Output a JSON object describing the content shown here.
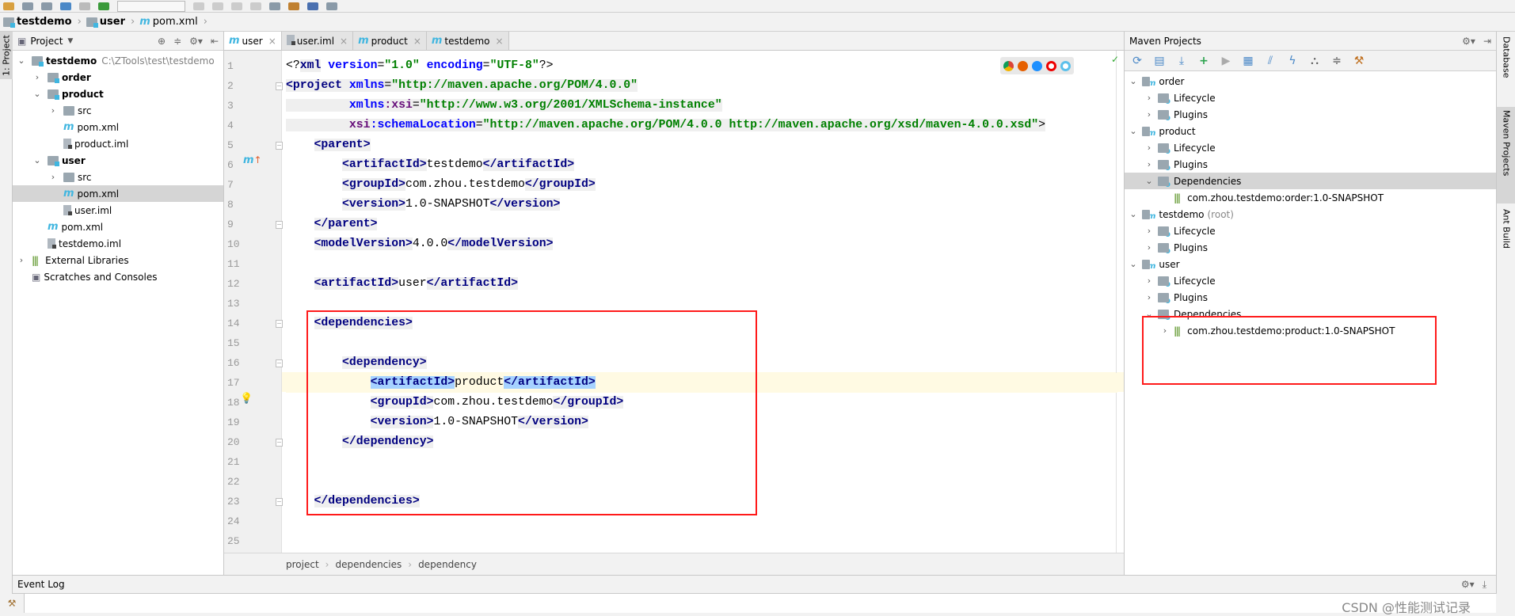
{
  "navbar": {
    "crumbs": [
      "testdemo",
      "user",
      "pom.xml"
    ]
  },
  "left_strip": {
    "project_tab": "1: Project"
  },
  "project_panel": {
    "title": "Project",
    "items": [
      {
        "label": "testdemo",
        "path": "C:\\ZTools\\test\\testdemo",
        "depth": 0,
        "arrow": "open",
        "icon": "module-folder",
        "bold": true
      },
      {
        "label": "order",
        "depth": 1,
        "arrow": "closed",
        "icon": "module-folder",
        "bold": true
      },
      {
        "label": "product",
        "depth": 1,
        "arrow": "open",
        "icon": "module-folder",
        "bold": true
      },
      {
        "label": "src",
        "depth": 2,
        "arrow": "closed",
        "icon": "folder"
      },
      {
        "label": "pom.xml",
        "depth": 2,
        "icon": "maven-file"
      },
      {
        "label": "product.iml",
        "depth": 2,
        "icon": "iml-file"
      },
      {
        "label": "user",
        "depth": 1,
        "arrow": "open",
        "icon": "module-folder",
        "bold": true
      },
      {
        "label": "src",
        "depth": 2,
        "arrow": "closed",
        "icon": "folder"
      },
      {
        "label": "pom.xml",
        "depth": 2,
        "icon": "maven-file",
        "selected": true
      },
      {
        "label": "user.iml",
        "depth": 2,
        "icon": "iml-file"
      },
      {
        "label": "pom.xml",
        "depth": 1,
        "icon": "maven-file"
      },
      {
        "label": "testdemo.iml",
        "depth": 1,
        "icon": "iml-file"
      },
      {
        "label": "External Libraries",
        "depth": 0,
        "arrow": "closed",
        "icon": "library"
      },
      {
        "label": "Scratches and Consoles",
        "depth": 0,
        "icon": "scratches"
      }
    ]
  },
  "editor": {
    "tabs": [
      {
        "label": "user",
        "icon": "maven-file",
        "active": true
      },
      {
        "label": "user.iml",
        "icon": "iml-file"
      },
      {
        "label": "product",
        "icon": "maven-file"
      },
      {
        "label": "testdemo",
        "icon": "maven-file"
      }
    ],
    "close_glyph": "×",
    "current_line": 17,
    "lines": [
      [
        [
          "punct",
          "<?"
        ],
        [
          "tag",
          "xml"
        ],
        [
          "attr",
          " version"
        ],
        [
          "punct",
          "="
        ],
        [
          "val",
          "\"1.0\""
        ],
        [
          "attr",
          " encoding"
        ],
        [
          "punct",
          "="
        ],
        [
          "val",
          "\"UTF-8\""
        ],
        [
          "punct",
          "?>"
        ]
      ],
      [
        [
          "tag",
          "<project"
        ],
        [
          "attr",
          " xmlns"
        ],
        [
          "punct",
          "="
        ],
        [
          "val",
          "\"http://maven.apache.org/POM/4.0.0\""
        ]
      ],
      [
        [
          "text",
          "         "
        ],
        [
          "attr",
          "xmlns"
        ],
        [
          "ns",
          ":xsi"
        ],
        [
          "punct",
          "="
        ],
        [
          "val",
          "\"http://www.w3.org/2001/XMLSchema-instance\""
        ]
      ],
      [
        [
          "text",
          "         "
        ],
        [
          "ns",
          "xsi"
        ],
        [
          "attr",
          ":schemaLocation"
        ],
        [
          "punct",
          "="
        ],
        [
          "val",
          "\"http://maven.apache.org/POM/4.0.0 http://maven.apache.org/xsd/maven-4.0.0.xsd\""
        ],
        [
          "punct",
          ">"
        ]
      ],
      [
        [
          "text",
          "    "
        ],
        [
          "tag",
          "<parent>"
        ]
      ],
      [
        [
          "text",
          "        "
        ],
        [
          "tag",
          "<artifactId>"
        ],
        [
          "text",
          "testdemo"
        ],
        [
          "tag",
          "</artifactId>"
        ]
      ],
      [
        [
          "text",
          "        "
        ],
        [
          "tag",
          "<groupId>"
        ],
        [
          "text",
          "com.zhou.testdemo"
        ],
        [
          "tag",
          "</groupId>"
        ]
      ],
      [
        [
          "text",
          "        "
        ],
        [
          "tag",
          "<version>"
        ],
        [
          "text",
          "1.0-SNAPSHOT"
        ],
        [
          "tag",
          "</version>"
        ]
      ],
      [
        [
          "text",
          "    "
        ],
        [
          "tag",
          "</parent>"
        ]
      ],
      [
        [
          "text",
          "    "
        ],
        [
          "tag",
          "<modelVersion>"
        ],
        [
          "text",
          "4.0.0"
        ],
        [
          "tag",
          "</modelVersion>"
        ]
      ],
      [],
      [
        [
          "text",
          "    "
        ],
        [
          "tag",
          "<artifactId>"
        ],
        [
          "text",
          "user"
        ],
        [
          "tag",
          "</artifactId>"
        ]
      ],
      [],
      [
        [
          "text",
          "    "
        ],
        [
          "tag",
          "<dependencies>"
        ]
      ],
      [],
      [
        [
          "text",
          "        "
        ],
        [
          "tag",
          "<dependency>"
        ]
      ],
      [
        [
          "text",
          "            "
        ],
        [
          "sel",
          "<artifactId>"
        ],
        [
          "text",
          "product"
        ],
        [
          "sel",
          "</artifactId>"
        ]
      ],
      [
        [
          "text",
          "            "
        ],
        [
          "tag",
          "<groupId>"
        ],
        [
          "text",
          "com.zhou.testdemo"
        ],
        [
          "tag",
          "</groupId>"
        ]
      ],
      [
        [
          "text",
          "            "
        ],
        [
          "tag",
          "<version>"
        ],
        [
          "text",
          "1.0-SNAPSHOT"
        ],
        [
          "tag",
          "</version>"
        ]
      ],
      [
        [
          "text",
          "        "
        ],
        [
          "tag",
          "</dependency>"
        ]
      ],
      [],
      [],
      [
        [
          "text",
          "    "
        ],
        [
          "tag",
          "</dependencies>"
        ]
      ],
      [],
      []
    ],
    "breadcrumb": [
      "project",
      "dependencies",
      "dependency"
    ]
  },
  "maven_panel": {
    "title": "Maven Projects",
    "items": [
      {
        "label": "order",
        "depth": 0,
        "arrow": "open",
        "icon": "maven-module"
      },
      {
        "label": "Lifecycle",
        "depth": 1,
        "arrow": "closed",
        "icon": "lifecycle-folder"
      },
      {
        "label": "Plugins",
        "depth": 1,
        "arrow": "closed",
        "icon": "plugins-folder"
      },
      {
        "label": "product",
        "depth": 0,
        "arrow": "open",
        "icon": "maven-module"
      },
      {
        "label": "Lifecycle",
        "depth": 1,
        "arrow": "closed",
        "icon": "lifecycle-folder"
      },
      {
        "label": "Plugins",
        "depth": 1,
        "arrow": "closed",
        "icon": "plugins-folder"
      },
      {
        "label": "Dependencies",
        "depth": 1,
        "arrow": "open",
        "icon": "dependencies-folder",
        "selected": true
      },
      {
        "label": "com.zhou.testdemo:order:1.0-SNAPSHOT",
        "depth": 2,
        "icon": "library"
      },
      {
        "label": "testdemo",
        "suffix": "(root)",
        "depth": 0,
        "arrow": "open",
        "icon": "maven-module"
      },
      {
        "label": "Lifecycle",
        "depth": 1,
        "arrow": "closed",
        "icon": "lifecycle-folder"
      },
      {
        "label": "Plugins",
        "depth": 1,
        "arrow": "closed",
        "icon": "plugins-folder"
      },
      {
        "label": "user",
        "depth": 0,
        "arrow": "open",
        "icon": "maven-module"
      },
      {
        "label": "Lifecycle",
        "depth": 1,
        "arrow": "closed",
        "icon": "lifecycle-folder"
      },
      {
        "label": "Plugins",
        "depth": 1,
        "arrow": "closed",
        "icon": "plugins-folder"
      },
      {
        "label": "Dependencies",
        "depth": 1,
        "arrow": "open",
        "icon": "dependencies-folder"
      },
      {
        "label": "com.zhou.testdemo:product:1.0-SNAPSHOT",
        "depth": 2,
        "arrow": "closed",
        "icon": "library"
      }
    ]
  },
  "right_strip": {
    "tabs": [
      "Database",
      "Maven Projects",
      "Ant Build"
    ]
  },
  "event_log": {
    "title": "Event Log"
  },
  "watermark": "CSDN @性能测试记录",
  "colors": {
    "annotation_box": "#ff1a1a",
    "maven_accent": "#40b6e0",
    "current_line": "#fffae3",
    "tag_selected": "#a6d2ff"
  }
}
